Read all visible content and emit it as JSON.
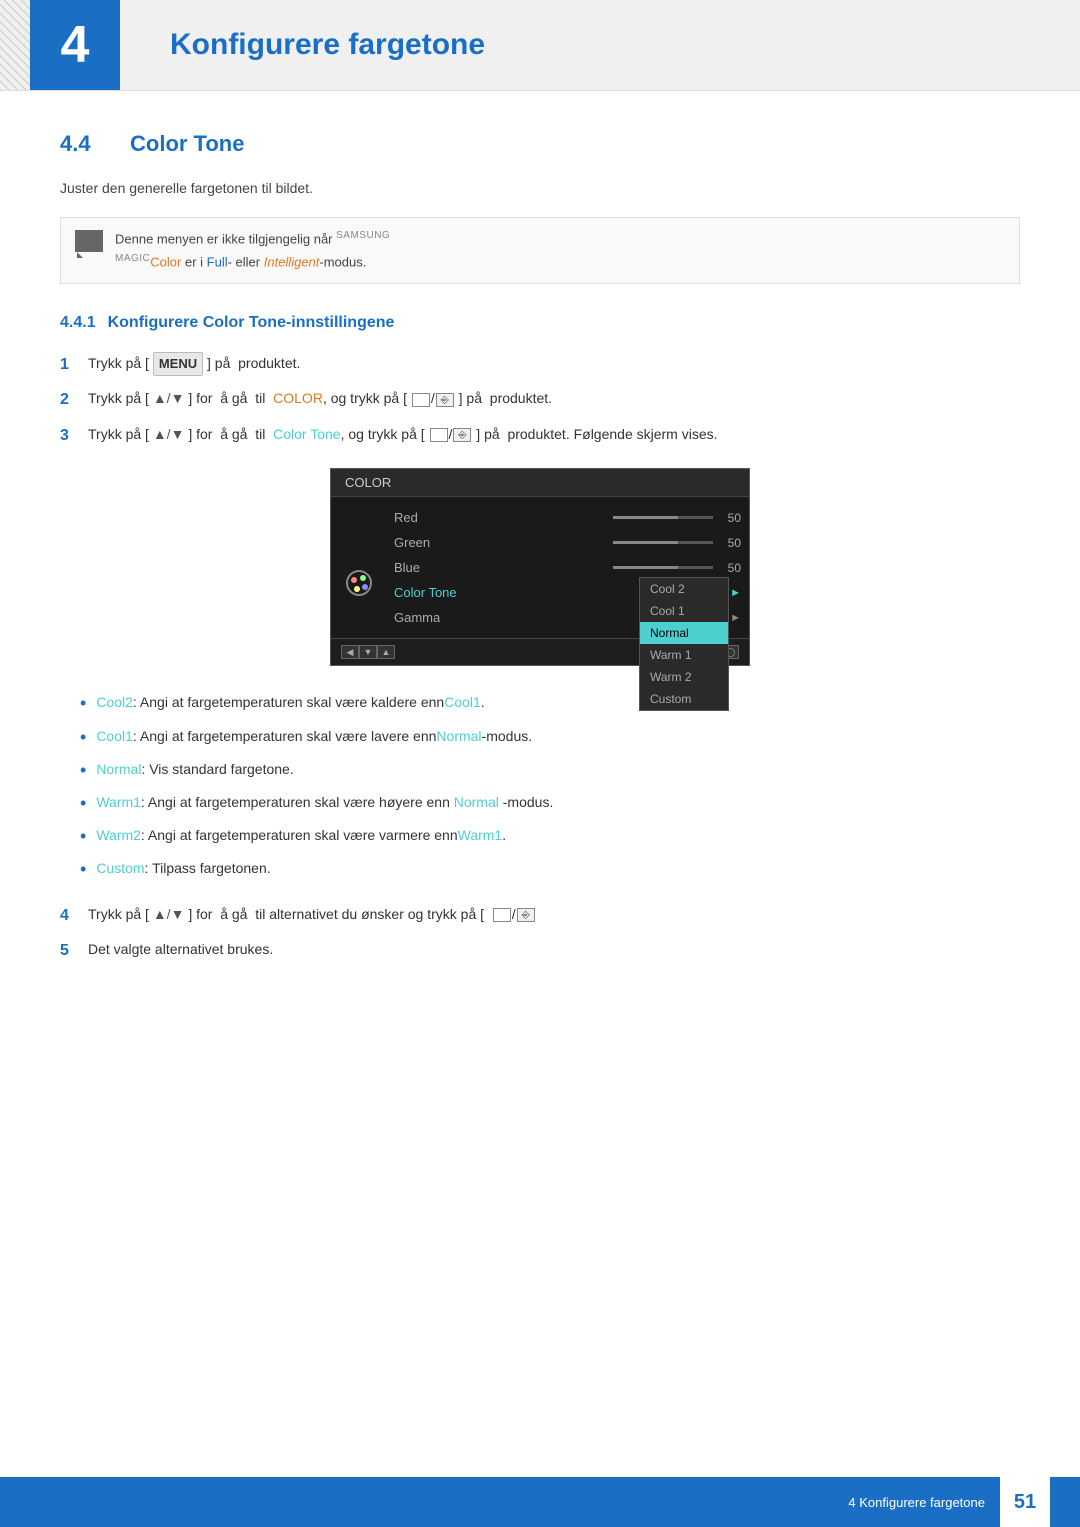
{
  "header": {
    "chapter_number": "4",
    "chapter_title": "Konfigurere fargetone"
  },
  "section": {
    "number": "4.4",
    "title": "Color Tone"
  },
  "description": "Juster den generelle fargetonen til bildet.",
  "note": {
    "text": "Denne menyen er ikke tilgjengelig n år SAMSUNGMAGICColor er i Full- eller Intelligent-modus."
  },
  "subsection": {
    "number": "4.4.1",
    "title": "Konfigurere Color Tone-innstillingene"
  },
  "steps": [
    {
      "number": "1",
      "text": "Trykk på [ MENU ] på produktet."
    },
    {
      "number": "2",
      "text": "Trykk på [ ▲/▼ ] for å gå til  COLOR, og trykk på [ □/⎆ ] på produktet."
    },
    {
      "number": "3",
      "text": "Trykk på [ ▲/▼ ] for å gå til  Color Tone, og trykk på [ □/⎆ ] på produktet. Følgende skjerm vises."
    }
  ],
  "color_menu": {
    "title": "COLOR",
    "items": [
      {
        "label": "Red",
        "value": "50",
        "type": "slider"
      },
      {
        "label": "Green",
        "value": "50",
        "type": "slider"
      },
      {
        "label": "Blue",
        "value": "50",
        "type": "slider"
      },
      {
        "label": "Color Tone",
        "type": "submenu",
        "active": true
      },
      {
        "label": "Gamma",
        "type": "submenu"
      }
    ],
    "submenu": [
      {
        "label": "Cool 2",
        "state": "normal"
      },
      {
        "label": "Cool 1",
        "state": "normal"
      },
      {
        "label": "Normal",
        "state": "selected"
      },
      {
        "label": "Warm 1",
        "state": "normal"
      },
      {
        "label": "Warm 2",
        "state": "normal"
      },
      {
        "label": "Custom",
        "state": "normal"
      }
    ]
  },
  "bullet_items": [
    {
      "term": "Cool2",
      "text": ": Angi at fargetemperaturen skal være kaldere enn",
      "ref": "Cool1",
      "suffix": "."
    },
    {
      "term": "Cool1",
      "text": ": Angi at fargetemperaturen skal være lavere enn",
      "ref": "Normal",
      "suffix": "-modus."
    },
    {
      "term": "Normal",
      "text": ": Vis standard fargetone.",
      "ref": "",
      "suffix": ""
    },
    {
      "term": "Warm1",
      "text": ": Angi at fargetemperaturen skal være høyere enn ",
      "ref": "Normal",
      "suffix": "-modus."
    },
    {
      "term": "Warm2",
      "text": ": Angi at fargetemperaturen skal være varmere enn",
      "ref": "Warm1",
      "suffix": "."
    },
    {
      "term": "Custom",
      "text": ": Tilpass fargetonen.",
      "ref": "",
      "suffix": ""
    }
  ],
  "steps_after": [
    {
      "number": "4",
      "text": "Trykk på [ ▲/▼ ] for å gå til alternativet du ønsker og trykk på [ □/⎆"
    },
    {
      "number": "5",
      "text": "Det valgte alternativet brukes."
    }
  ],
  "footer": {
    "chapter_label": "4 Konfigurere fargetone",
    "page_number": "51"
  }
}
